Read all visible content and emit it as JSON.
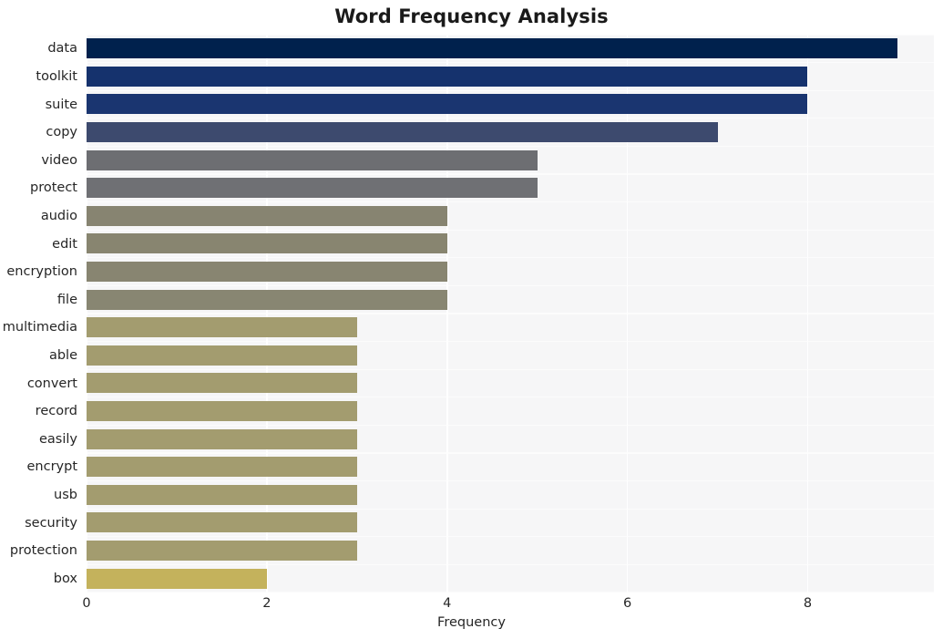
{
  "chart_data": {
    "type": "bar",
    "orientation": "horizontal",
    "title": "Word Frequency Analysis",
    "xlabel": "Frequency",
    "ylabel": "",
    "xlim": [
      0,
      9.4
    ],
    "ylim_categories_top_to_bottom": true,
    "xticks": [
      0,
      2,
      4,
      6,
      8
    ],
    "xtick_labels": [
      "0",
      "2",
      "4",
      "6",
      "8"
    ],
    "grid": "x-gridlines-white-on-light-gray",
    "legend": "none",
    "background": "#f6f6f7",
    "categories": [
      "data",
      "toolkit",
      "suite",
      "copy",
      "video",
      "protect",
      "audio",
      "edit",
      "encryption",
      "file",
      "multimedia",
      "able",
      "convert",
      "record",
      "easily",
      "encrypt",
      "usb",
      "security",
      "protection",
      "box"
    ],
    "values": [
      9,
      8,
      8,
      7,
      5,
      5,
      4,
      4,
      4,
      4,
      3,
      3,
      3,
      3,
      3,
      3,
      3,
      3,
      3,
      2
    ],
    "bar_colors": [
      "#00214d",
      "#15326d",
      "#1a3570",
      "#3d4a6e",
      "#6d6e72",
      "#6f7074",
      "#878471",
      "#888570",
      "#888571",
      "#888672",
      "#a39c6f",
      "#a39c6f",
      "#a39c6f",
      "#a39c6f",
      "#a39c6f",
      "#a39c6f",
      "#a39c6f",
      "#a39c6f",
      "#a39c6f",
      "#c4b25c"
    ]
  }
}
